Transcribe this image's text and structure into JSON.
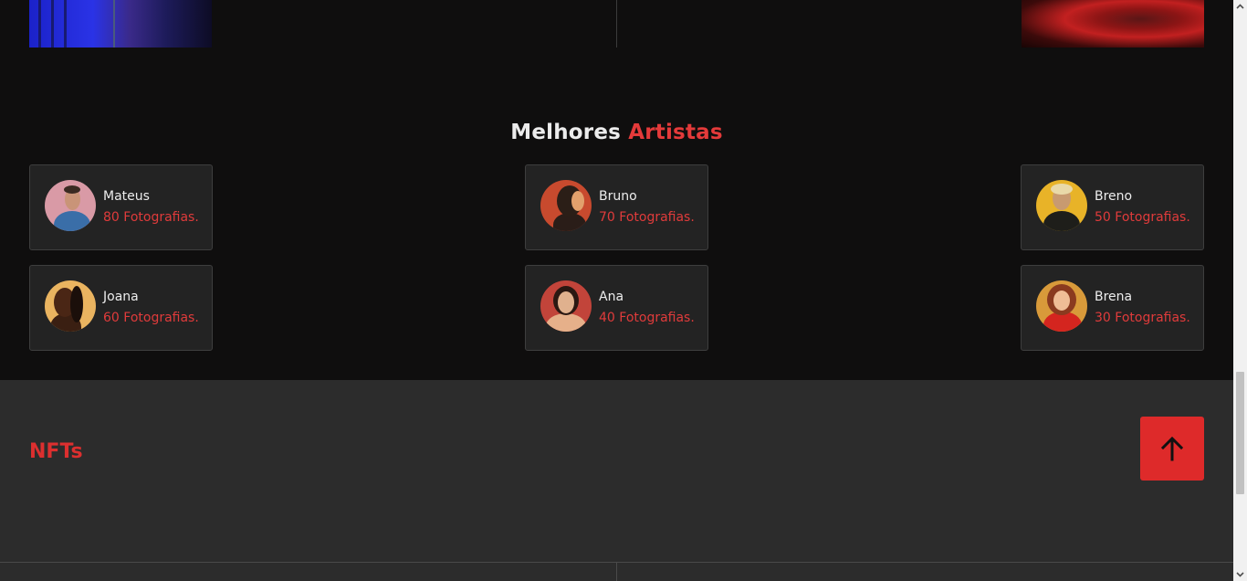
{
  "section": {
    "title_white": "Melhores",
    "title_red": "Artistas"
  },
  "artists": [
    {
      "name": "Mateus",
      "count": "80 Fotografias."
    },
    {
      "name": "Bruno",
      "count": "70 Fotografias."
    },
    {
      "name": "Breno",
      "count": "50 Fotografias."
    },
    {
      "name": "Joana",
      "count": "60 Fotografias."
    },
    {
      "name": "Ana",
      "count": "40 Fotografias."
    },
    {
      "name": "Brena",
      "count": "30 Fotografias."
    }
  ],
  "nft": {
    "title": "NFTs"
  },
  "back_to_top": {
    "icon": "arrow-up-icon"
  },
  "colors": {
    "accent": "#e03b3b",
    "background": "#0f0e0e",
    "card": "#232323",
    "footer": "#2c2c2c"
  }
}
